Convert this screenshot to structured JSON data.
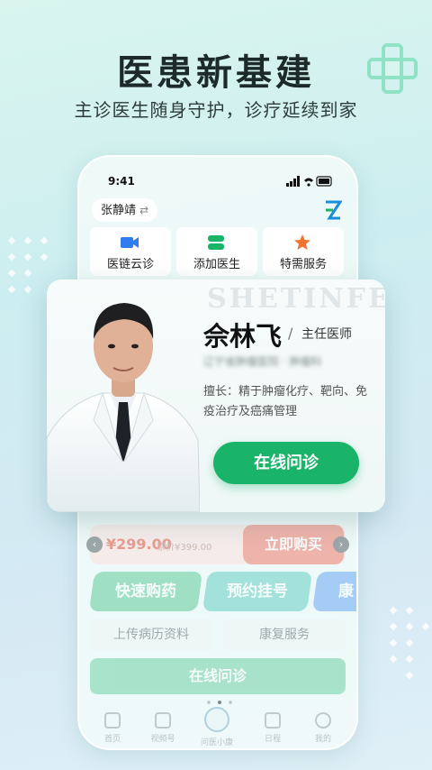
{
  "headline": "医患新基建",
  "subline": "主诊医生随身守护，诊疗延续到家",
  "colors": {
    "brand_green": "#19b36a",
    "accent_teal": "#5fcd9c",
    "buy_red": "#ef7b6b"
  },
  "phone": {
    "status_time": "9:41",
    "user_name": "张静靖",
    "user_switch": "⇄",
    "quick_actions": [
      {
        "label": "医链云诊",
        "icon": "video-camera-icon"
      },
      {
        "label": "添加医生",
        "icon": "add-doctor-icon"
      },
      {
        "label": "特需服务",
        "icon": "star-icon"
      }
    ],
    "product": {
      "price": "¥299.00",
      "original_price": "原价¥399.00",
      "buy_label": "立即购买",
      "prev": "‹",
      "next": "›"
    },
    "services": [
      "快速购药",
      "预约挂号",
      "康"
    ],
    "secondary_services": [
      "上传病历资料",
      "康复服务"
    ],
    "bottom_button": "在线问诊",
    "tabs": [
      "首页",
      "视频号",
      "问医小康",
      "日程",
      "我的"
    ]
  },
  "doctor": {
    "watermark": "SHETINFEI",
    "name": "佘林飞",
    "separator": "/",
    "title": "主任医师",
    "hospital": "辽宁省肿瘤医院 · 肿瘤科",
    "specialty": "擅长：精于肿瘤化疗、靶向、免疫治疗及癌痛管理",
    "consult_label": "在线问诊"
  }
}
